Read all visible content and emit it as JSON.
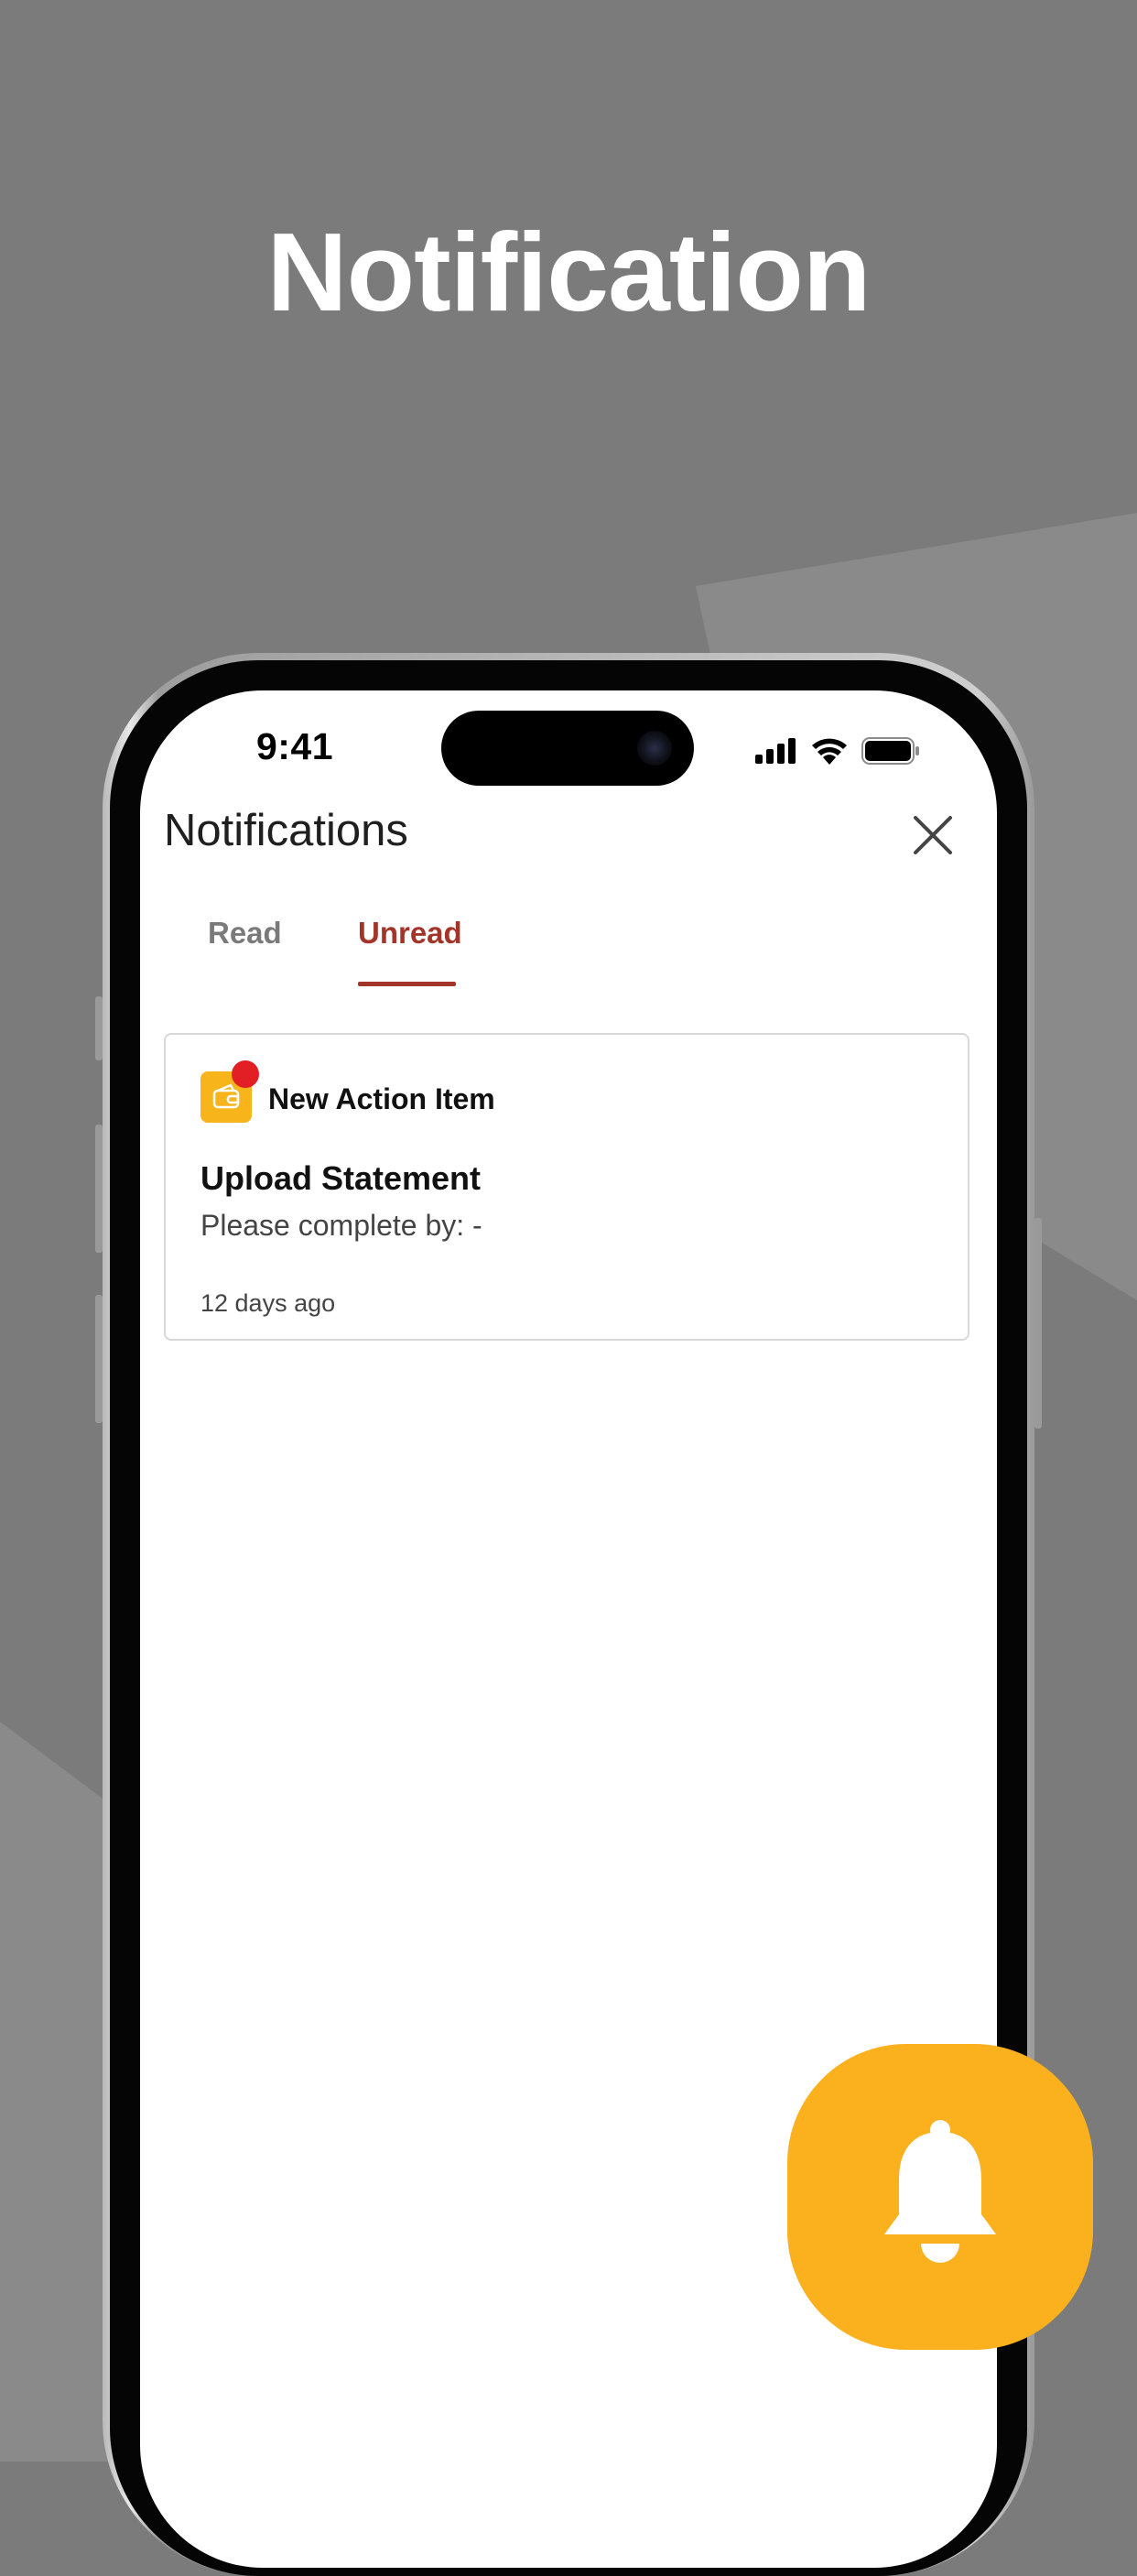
{
  "hero": {
    "title": "Notification"
  },
  "status_bar": {
    "time": "9:41",
    "icons": [
      "cellular-signal-icon",
      "wifi-icon",
      "battery-icon"
    ]
  },
  "app": {
    "title": "Notifications",
    "close_icon": "close-icon"
  },
  "tabs": [
    {
      "label": "Read",
      "active": false
    },
    {
      "label": "Unread",
      "active": true
    }
  ],
  "notifications": [
    {
      "icon": "wallet-icon",
      "type": "New Action Item",
      "title": "Upload Statement",
      "subtitle": "Please complete by: -",
      "time": "12 days ago",
      "unread": true
    }
  ],
  "badge": {
    "icon": "bell-icon"
  },
  "colors": {
    "background": "#7b7b7b",
    "accent": "#a3342a",
    "brand_yellow": "#fbb11d",
    "unread_dot": "#e21f25"
  }
}
